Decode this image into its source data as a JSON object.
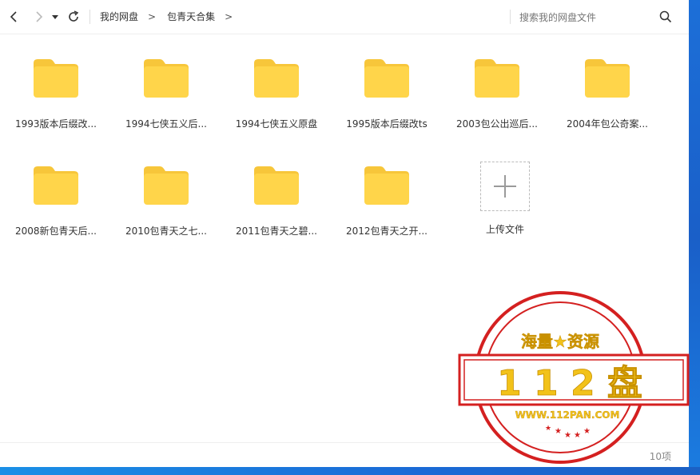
{
  "toolbar": {
    "back_icon": "chevron-left-icon",
    "forward_icon": "chevron-right-icon",
    "history_icon": "caret-down-icon",
    "refresh_icon": "refresh-icon",
    "breadcrumb": [
      "我的网盘",
      "包青天合集"
    ],
    "search_placeholder": "搜索我的网盘文件"
  },
  "folders": [
    {
      "label": "1993版本后缀改..."
    },
    {
      "label": "1994七侠五义后..."
    },
    {
      "label": "1994七侠五义原盘"
    },
    {
      "label": "1995版本后缀改ts"
    },
    {
      "label": "2003包公出巡后..."
    },
    {
      "label": "2004年包公奇案..."
    },
    {
      "label": "2008新包青天后..."
    },
    {
      "label": "2010包青天之七..."
    },
    {
      "label": "2011包青天之碧..."
    },
    {
      "label": "2012包青天之开..."
    }
  ],
  "upload": {
    "label": "上传文件"
  },
  "status": {
    "count": "10项"
  },
  "watermark": {
    "top_text": "海量★资源",
    "main_text": "1 1 2 盘",
    "url": "WWW.112PAN.COM",
    "color": "#d42020",
    "text_color": "#f2c21a"
  },
  "colors": {
    "folder": "#ffd54a",
    "folder_tab": "#f7c63a"
  }
}
